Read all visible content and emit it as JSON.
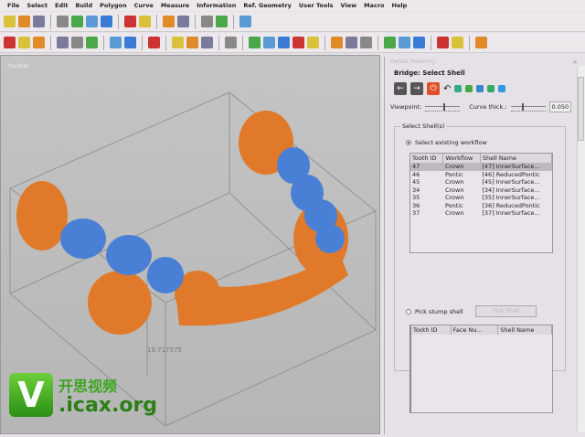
{
  "menu": [
    "File",
    "Select",
    "Edit",
    "Build",
    "Polygon",
    "Curve",
    "Measure",
    "Information",
    "Ref. Geometry",
    "User Tools",
    "View",
    "Macro",
    "Help"
  ],
  "viewport": {
    "label": "Parallel",
    "dimension": "19.717575"
  },
  "panel": {
    "title": "Dental Modeling",
    "subtitle": "Bridge: Select Shell",
    "viewpoint_label": "Viewpoint:",
    "curve_label": "Curve thick.:",
    "curve_value": "0.050",
    "viewpoint_level": 0.55,
    "curve_level": 0.35,
    "group_title": "Select Shell(s)",
    "radio1": "Select existing workflow",
    "radio2": "Pick stump shell",
    "stump_button": "Pick Shell",
    "table1": {
      "headers": [
        "Tooth ID",
        "Workflow",
        "Shell Name"
      ],
      "rows": [
        [
          "47",
          "Crown",
          "[47] InnerSurface..."
        ],
        [
          "46",
          "Pontic",
          "[46] ReducedPontic"
        ],
        [
          "45",
          "Crown",
          "[45] InnerSurface..."
        ],
        [
          "34",
          "Crown",
          "[34] InnerSurface..."
        ],
        [
          "35",
          "Crown",
          "[35] InnerSurface..."
        ],
        [
          "36",
          "Pontic",
          "[36] ReducedPontic"
        ],
        [
          "37",
          "Crown",
          "[37] InnerSurface..."
        ]
      ]
    },
    "table2": {
      "headers": [
        "Tooth ID",
        "Face Nu...",
        "Shell Name"
      ]
    }
  },
  "watermark": {
    "logo": "V",
    "cn": "开思视频",
    "url": ".icax.org"
  }
}
